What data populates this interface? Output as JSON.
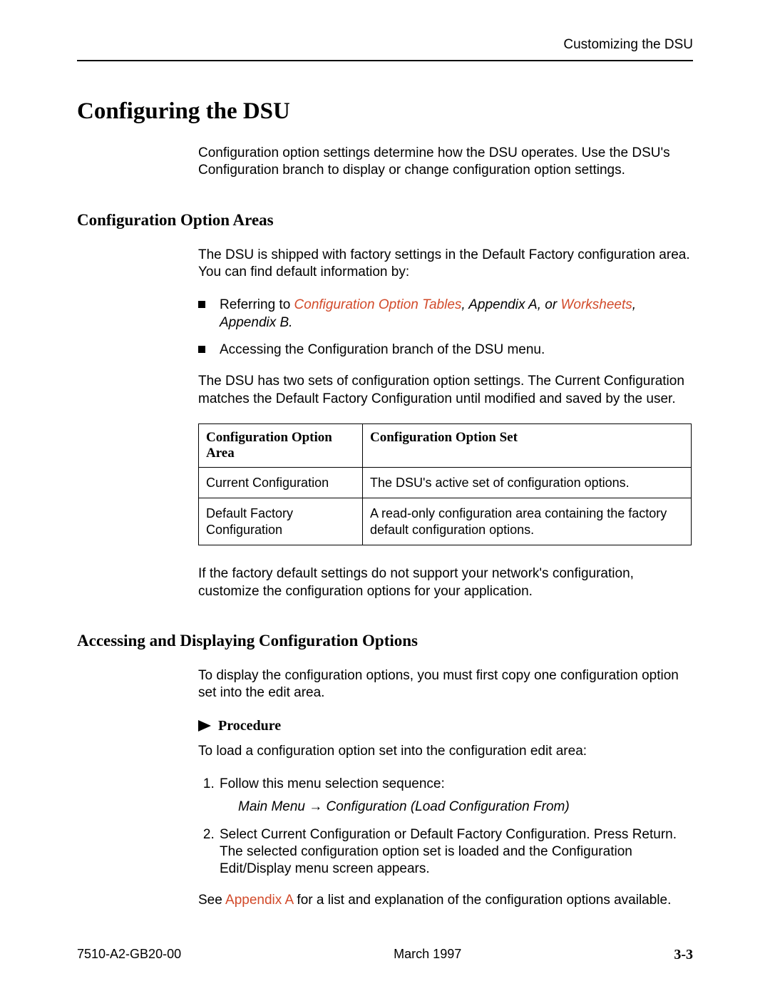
{
  "running_head": "Customizing the DSU",
  "h1": "Configuring the DSU",
  "intro": "Configuration option settings determine how the DSU operates. Use the DSU's Configuration branch to display or change configuration option settings.",
  "section1": {
    "heading": "Configuration Option Areas",
    "para1": "The DSU is shipped with factory settings in the Default Factory configuration area. You can find default information by:",
    "bullet1_pre": "Referring to ",
    "bullet1_link1": "Configuration Option Tables",
    "bullet1_mid": ", Appendix A, or ",
    "bullet1_link2": "Worksheets",
    "bullet1_post": ", Appendix B.",
    "bullet2": "Accessing the Configuration branch of the DSU menu.",
    "para2": "The DSU has two sets of configuration option settings. The Current Configuration matches the Default Factory Configuration until modified and saved by the user.",
    "table": {
      "th1": "Configuration Option Area",
      "th2": "Configuration Option Set",
      "r1c1": "Current Configuration",
      "r1c2": "The DSU's active set of configuration options.",
      "r2c1": "Default Factory Configuration",
      "r2c2": "A read-only configuration area containing the factory default configuration options."
    },
    "para3": "If the factory default settings do not support your network's configuration, customize the configuration options for your application."
  },
  "section2": {
    "heading": "Accessing and Displaying Configuration Options",
    "para1": "To display the configuration options, you must first copy one configuration option set into the edit area.",
    "procedure_label": "Procedure",
    "proc_intro": "To load a configuration option set into the configuration edit area:",
    "step1": "Follow this menu selection sequence:",
    "step1_path": "Main Menu → Configuration (Load Configuration From)",
    "step2": "Select Current Configuration or Default Factory Configuration. Press Return. The selected configuration option set is loaded and the Configuration Edit/Display menu screen appears.",
    "closing_pre": "See ",
    "closing_link": "Appendix A",
    "closing_post": " for a list and explanation of the configuration options available."
  },
  "footer": {
    "left": "7510-A2-GB20-00",
    "center": "March 1997",
    "right": "3-3"
  }
}
